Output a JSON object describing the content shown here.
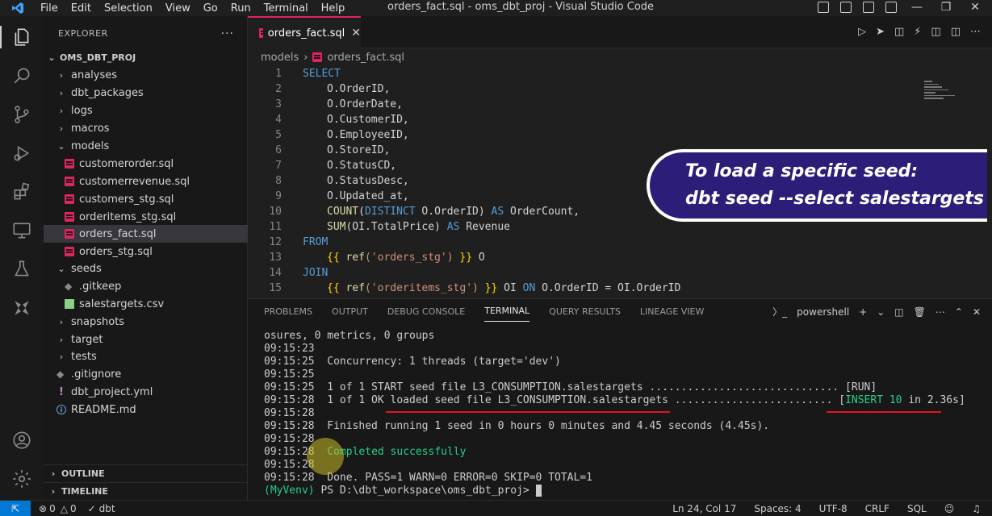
{
  "window": {
    "title": "orders_fact.sql - oms_dbt_proj - Visual Studio Code",
    "menu": [
      "File",
      "Edit",
      "Selection",
      "View",
      "Go",
      "Run",
      "Terminal",
      "Help"
    ]
  },
  "sidebar": {
    "header": "EXPLORER",
    "more": "...",
    "root": "OMS_DBT_PROJ",
    "items": [
      {
        "label": "analyses",
        "type": "folder",
        "open": false
      },
      {
        "label": "dbt_packages",
        "type": "folder",
        "open": false
      },
      {
        "label": "logs",
        "type": "folder",
        "open": false
      },
      {
        "label": "macros",
        "type": "folder",
        "open": false
      },
      {
        "label": "models",
        "type": "folder",
        "open": true
      },
      {
        "label": "customerorder.sql",
        "type": "sql"
      },
      {
        "label": "customerrevenue.sql",
        "type": "sql"
      },
      {
        "label": "customers_stg.sql",
        "type": "sql"
      },
      {
        "label": "orderitems_stg.sql",
        "type": "sql"
      },
      {
        "label": "orders_fact.sql",
        "type": "sql",
        "selected": true
      },
      {
        "label": "orders_stg.sql",
        "type": "sql"
      },
      {
        "label": "seeds",
        "type": "folder",
        "open": true
      },
      {
        "label": ".gitkeep",
        "type": "git"
      },
      {
        "label": "salestargets.csv",
        "type": "csv"
      },
      {
        "label": "snapshots",
        "type": "folder",
        "open": false
      },
      {
        "label": "target",
        "type": "folder",
        "open": false
      },
      {
        "label": "tests",
        "type": "folder",
        "open": false
      },
      {
        "label": ".gitignore",
        "type": "git"
      },
      {
        "label": "dbt_project.yml",
        "type": "yml"
      },
      {
        "label": "README.md",
        "type": "info"
      }
    ],
    "outline": "OUTLINE",
    "timeline": "TIMELINE"
  },
  "editor": {
    "tab": "orders_fact.sql",
    "breadcrumb": [
      "models",
      "orders_fact.sql"
    ],
    "lines": [
      "1",
      "2",
      "3",
      "4",
      "5",
      "6",
      "7",
      "8",
      "9",
      "10",
      "11",
      "12",
      "13",
      "14",
      "15"
    ],
    "code": {
      "l1": "SELECT",
      "l2": "O.OrderID,",
      "l3": "O.OrderDate,",
      "l4": "O.CustomerID,",
      "l5": "O.EmployeeID,",
      "l6": "O.StoreID,",
      "l7": "O.StatusCD,",
      "l8": "O.StatusDesc,",
      "l9": "O.Updated_at,",
      "l10_fn": "COUNT",
      "l10_a": "(",
      "l10_kw": "DISTINCT",
      "l10_b": " O.OrderID) ",
      "l10_as": "AS",
      "l10_c": " OrderCount,",
      "l11_fn": "SUM",
      "l11_a": "(OI.TotalPrice) ",
      "l11_as": "AS",
      "l11_c": " Revenue",
      "l12": "FROM",
      "l13_open": "{{ ",
      "l13_fn": "ref",
      "l13_str": "('orders_stg')",
      "l13_close": " }}",
      "l13_alias": " O",
      "l14": "JOIN",
      "l15_open": "{{ ",
      "l15_fn": "ref",
      "l15_str": "('orderitems_stg')",
      "l15_close": " }}",
      "l15_alias": " OI ",
      "l15_on": "ON",
      "l15_rest": " O.OrderID = OI.OrderID"
    }
  },
  "banner": {
    "line1": "To load a specific seed:",
    "line2": "dbt seed --select salestargets"
  },
  "panel": {
    "tabs": [
      "PROBLEMS",
      "OUTPUT",
      "DEBUG CONSOLE",
      "TERMINAL",
      "QUERY RESULTS",
      "LINEAGE VIEW"
    ],
    "active_tab": "TERMINAL",
    "shell": "powershell",
    "terminal": {
      "t1": "osures, 0 metrics, 0 groups",
      "t2": "09:15:23",
      "t3": "09:15:25  Concurrency: 1 threads (target='dev')",
      "t4": "09:15:25",
      "t5": "09:15:25  1 of 1 START seed file L3_CONSUMPTION.salestargets .............................. [RUN]",
      "t6_a": "09:15:28  1 of 1 OK loaded seed file L3_CONSUMPTION.salestargets ......................... [",
      "t6_g": "INSERT 10",
      "t6_b": " in 2.36s]",
      "t7": "09:15:28",
      "t8": "09:15:28  Finished running 1 seed in 0 hours 0 minutes and 4.45 seconds (4.45s).",
      "t9": "09:15:28",
      "t10_a": "09:15:28  ",
      "t10_g": "Completed successfully",
      "t11": "09:15:28",
      "t12": "09:15:28  Done. PASS=1 WARN=0 ERROR=0 SKIP=0 TOTAL=1",
      "t13_venv": "(MyVenv)",
      "t13_rest": " PS D:\\dbt_workspace\\oms_dbt_proj> "
    }
  },
  "status": {
    "problems": "0",
    "warnings": "0",
    "dbt": "dbt",
    "position": "Ln 24, Col 17",
    "spaces": "Spaces: 4",
    "encoding": "UTF-8",
    "eol": "CRLF",
    "language": "SQL"
  },
  "colors": {
    "accent": "#0078d4",
    "sql_icon": "#e0245e",
    "banner_bg": "#2b1d78",
    "underline": "#e81123",
    "success": "#23d18b"
  }
}
